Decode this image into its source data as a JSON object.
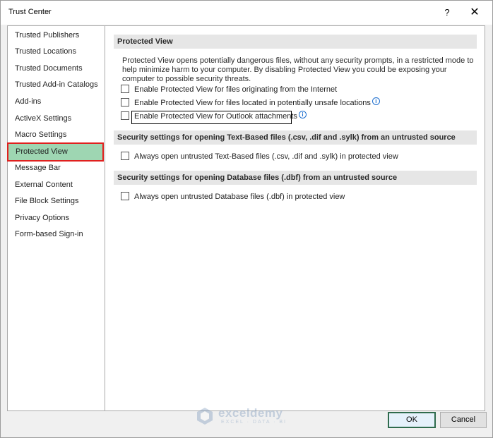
{
  "window": {
    "title": "Trust Center",
    "help_glyph": "?",
    "close_glyph": "✕"
  },
  "nav": {
    "items": [
      {
        "label": "Trusted Publishers"
      },
      {
        "label": "Trusted Locations"
      },
      {
        "label": "Trusted Documents"
      },
      {
        "label": "Trusted Add-in Catalogs"
      },
      {
        "label": "Add-ins"
      },
      {
        "label": "ActiveX Settings"
      },
      {
        "label": "Macro Settings"
      },
      {
        "label": "Protected View"
      },
      {
        "label": "Message Bar"
      },
      {
        "label": "External Content"
      },
      {
        "label": "File Block Settings"
      },
      {
        "label": "Privacy Options"
      },
      {
        "label": "Form-based Sign-in"
      }
    ],
    "selected": "Protected View"
  },
  "protected_view": {
    "header": "Protected View",
    "description": "Protected View opens potentially dangerous files, without any security prompts, in a restricted mode to help minimize harm to your computer. By disabling Protected View you could be exposing your computer to possible security threats.",
    "options": [
      {
        "label": "Enable Protected View for files originating from the Internet",
        "checked": false
      },
      {
        "label": "Enable Protected View for files located in potentially unsafe locations",
        "checked": false,
        "info": "i"
      },
      {
        "label": "Enable Protected View for Outlook attachments",
        "checked": false,
        "info": "i"
      }
    ]
  },
  "text_based": {
    "header": "Security settings for opening Text-Based files (.csv, .dif and .sylk) from an untrusted source",
    "option": {
      "label": "Always open untrusted Text-Based files (.csv, .dif and .sylk) in protected view",
      "checked": false
    }
  },
  "database": {
    "header": "Security settings for opening Database files (.dbf) from an untrusted source",
    "option": {
      "label": "Always open untrusted Database files (.dbf) in protected view",
      "checked": false
    }
  },
  "watermark": {
    "name": "exceldemy",
    "tagline": "EXCEL · DATA · BI"
  },
  "buttons": {
    "ok": "OK",
    "cancel": "Cancel"
  },
  "colors": {
    "selected_bg": "#9ed6b2",
    "selected_outline": "#e0201e",
    "info_blue": "#1e6fcf"
  }
}
